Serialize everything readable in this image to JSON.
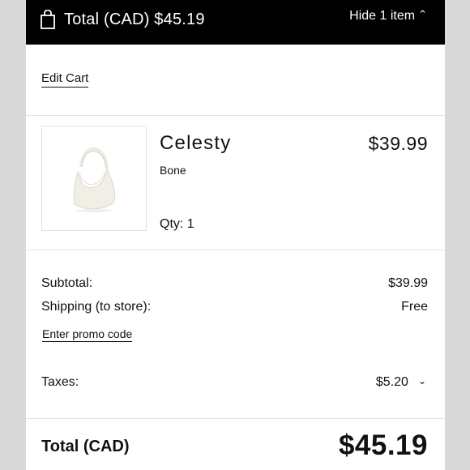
{
  "header": {
    "total_label": "Total (CAD) $45.19",
    "toggle_label": "Hide 1 item",
    "toggle_icon": "chevron-up-icon"
  },
  "cart": {
    "edit_label": "Edit Cart",
    "items": [
      {
        "name": "Celesty",
        "color": "Bone",
        "qty_label": "Qty: 1",
        "price": "$39.99"
      }
    ]
  },
  "summary": {
    "subtotal_label": "Subtotal:",
    "subtotal_value": "$39.99",
    "shipping_label": "Shipping (to store):",
    "shipping_value": "Free",
    "promo_label": "Enter promo code",
    "taxes_label": "Taxes:",
    "taxes_value": "$5.20",
    "taxes_icon": "chevron-down-icon"
  },
  "total": {
    "label": "Total (CAD)",
    "value": "$45.19"
  },
  "colors": {
    "header_bg": "#000000",
    "page_bg": "#d9d9d9",
    "panel_bg": "#ffffff",
    "text": "#111111"
  }
}
